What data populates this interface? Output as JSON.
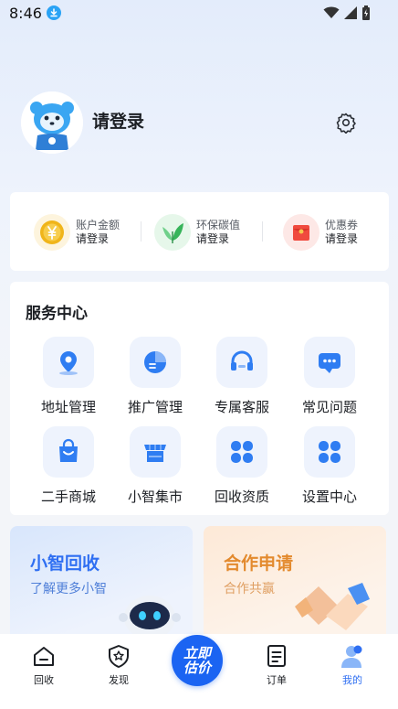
{
  "status_bar": {
    "time": "8:46"
  },
  "profile": {
    "login_text": "请登录"
  },
  "wallet": [
    {
      "label": "账户金额",
      "value": "请登录",
      "icon": "coin-icon",
      "color": "#f0b51a"
    },
    {
      "label": "环保碳值",
      "value": "请登录",
      "icon": "leaf-icon",
      "color": "#4cc26a"
    },
    {
      "label": "优惠券",
      "value": "请登录",
      "icon": "red-envelope-icon",
      "color": "#f04a3e"
    }
  ],
  "services": {
    "title": "服务中心",
    "items": [
      {
        "label": "地址管理",
        "icon": "location-pin-icon"
      },
      {
        "label": "推广管理",
        "icon": "pie-chart-icon"
      },
      {
        "label": "专属客服",
        "icon": "headset-icon"
      },
      {
        "label": "常见问题",
        "icon": "chat-bubble-icon"
      },
      {
        "label": "二手商城",
        "icon": "shopping-bag-icon"
      },
      {
        "label": "小智集市",
        "icon": "market-stall-icon"
      },
      {
        "label": "回收资质",
        "icon": "grid-apps-icon"
      },
      {
        "label": "设置中心",
        "icon": "grid-apps-icon"
      }
    ]
  },
  "promos": [
    {
      "title": "小智回收",
      "subtitle": "了解更多小智",
      "accent": "#2f6ff2"
    },
    {
      "title": "合作申请",
      "subtitle": "合作共赢",
      "accent": "#e38a2e"
    }
  ],
  "tabbar": {
    "items": [
      {
        "label": "回收",
        "icon": "home-icon"
      },
      {
        "label": "发现",
        "icon": "discover-badge-icon"
      },
      {
        "label": "订单",
        "icon": "order-list-icon"
      },
      {
        "label": "我的",
        "icon": "user-icon"
      }
    ],
    "center_label": "立即估价",
    "active_color": "#2f6ff2"
  }
}
